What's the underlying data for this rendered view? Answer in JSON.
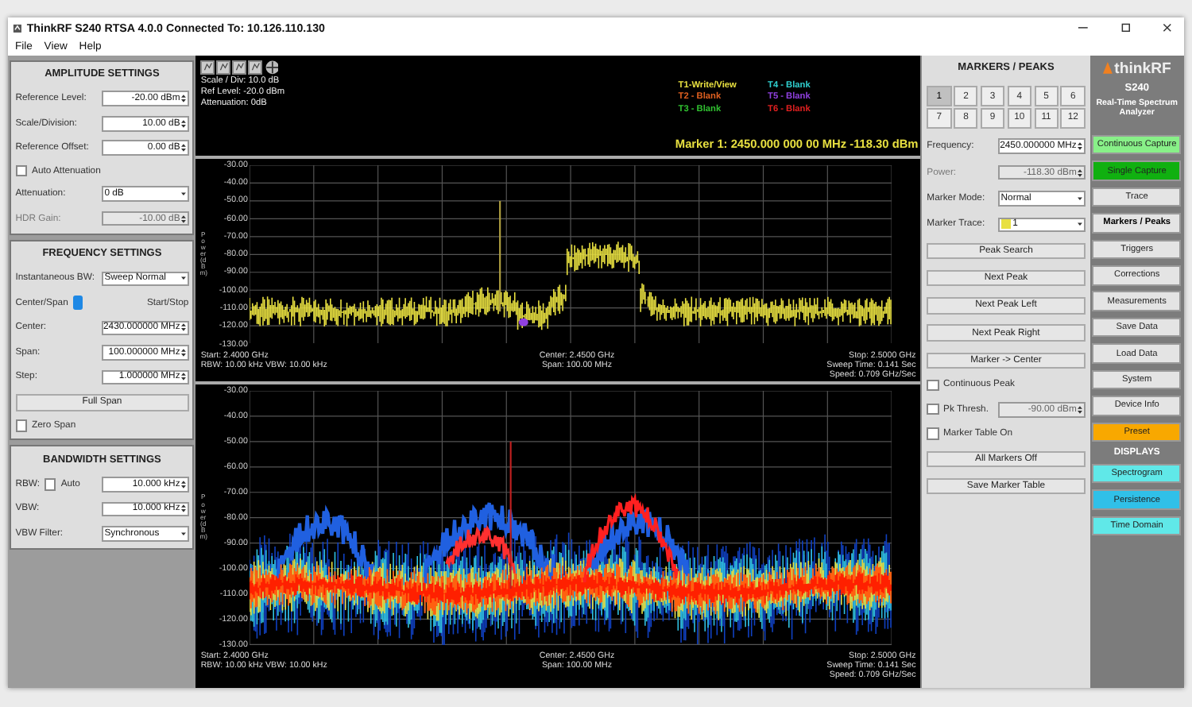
{
  "window": {
    "title": "ThinkRF S240 RTSA 4.0.0  Connected To: 10.126.110.130"
  },
  "menu": [
    "File",
    "View",
    "Help"
  ],
  "left_sections": [
    {
      "title": "AMPLITUDE SETTINGS",
      "rows": [
        {
          "kind": "spin",
          "label": "Reference Level:",
          "value": "-20.00 dBm",
          "disabled": false
        },
        {
          "kind": "spin",
          "label": "Scale/Division:",
          "value": "10.00 dB",
          "disabled": false
        },
        {
          "kind": "spin",
          "label": "Reference Offset:",
          "value": "0.00 dB",
          "disabled": false
        },
        {
          "kind": "checkbox",
          "label": "Auto Attenuation",
          "checked": false,
          "disabled": false
        },
        {
          "kind": "select",
          "label": "Attenuation:",
          "value": "0 dB",
          "disabled": false
        },
        {
          "kind": "spin",
          "label": "HDR Gain:",
          "value": "-10.00 dB",
          "disabled": true
        }
      ]
    },
    {
      "title": "FREQUENCY SETTINGS",
      "rows": [
        {
          "kind": "select",
          "label": "Instantaneous BW:",
          "value": "Sweep Normal",
          "disabled": false
        },
        {
          "kind": "toggle",
          "label": "Center/Span",
          "value": "Start/Stop",
          "on": false,
          "disabled": false
        },
        {
          "kind": "spin",
          "label": "Center:",
          "value": "2430.000000 MHz",
          "disabled": false
        },
        {
          "kind": "spin",
          "label": "Span:",
          "value": "100.000000 MHz",
          "disabled": false
        },
        {
          "kind": "spin",
          "label": "Step:",
          "value": "1.000000 MHz",
          "disabled": false
        },
        {
          "kind": "button",
          "label": "Full Span",
          "disabled": false
        },
        {
          "kind": "checkbox",
          "label": "Zero Span",
          "checked": false,
          "disabled": false
        }
      ]
    },
    {
      "title": "BANDWIDTH SETTINGS",
      "rows": [
        {
          "kind": "spin-auto",
          "label": "RBW:",
          "auto_label": "Auto",
          "checked": false,
          "value": "10.000 kHz",
          "disabled": false
        },
        {
          "kind": "spin",
          "label": "VBW:",
          "value": "10.000 kHz",
          "disabled": false
        },
        {
          "kind": "select",
          "label": "VBW Filter:",
          "value": "Synchronous",
          "disabled": false
        }
      ]
    }
  ],
  "display_info": [
    "Scale / Div: 10.0 dB",
    "Ref Level: -20.0 dBm",
    "Attenuation: 0dB"
  ],
  "traces": [
    {
      "label": "T1-Write/View",
      "color": "#e8e040"
    },
    {
      "label": "T4 - Blank",
      "color": "#30d0d0"
    },
    {
      "label": "T2 - Blank",
      "color": "#e06020"
    },
    {
      "label": "T5 - Blank",
      "color": "#9040e0"
    },
    {
      "label": "T3 - Blank",
      "color": "#30c030"
    },
    {
      "label": "T6 - Blank",
      "color": "#e02020"
    }
  ],
  "marker_readout": "Marker 1: 2450.000 000 00 MHz   -118.30 dBm",
  "plots": [
    {
      "kind": "trace",
      "y_axis_label": "Power (dBm)",
      "y_ticks": [
        "-30.00",
        "-40.00",
        "-50.00",
        "-60.00",
        "-70.00",
        "-80.00",
        "-90.00",
        "-100.00",
        "-110.00",
        "-120.00",
        "-130.00"
      ],
      "footer_left": [
        "Start: 2.4000 GHz",
        "RBW: 10.00 kHz  VBW: 10.00 kHz"
      ],
      "footer_center": [
        "Center: 2.4500 GHz",
        "Span: 100.00 MHz"
      ],
      "footer_right": [
        "Stop: 2.5000 GHz",
        "Sweep Time: 0.141 Sec",
        "Speed: 0.709 GHz/Sec"
      ]
    },
    {
      "kind": "persistence",
      "y_axis_label": "Power (dBm)",
      "y_ticks": [
        "-30.00",
        "-40.00",
        "-50.00",
        "-60.00",
        "-70.00",
        "-80.00",
        "-90.00",
        "-100.00",
        "-110.00",
        "-120.00",
        "-130.00"
      ],
      "footer_left": [
        "Start: 2.4000 GHz",
        "RBW: 10.00 kHz  VBW: 10.00 kHz"
      ],
      "footer_center": [
        "Center: 2.4500 GHz",
        "Span: 100.00 MHz"
      ],
      "footer_right": [
        "Stop: 2.5000 GHz",
        "Sweep Time: 0.141 Sec",
        "Speed: 0.709 GHz/Sec"
      ]
    }
  ],
  "markers": {
    "title": "MARKERS / PEAKS",
    "tabs": [
      {
        "label": "1",
        "selected": true
      },
      {
        "label": "2",
        "selected": false
      },
      {
        "label": "3",
        "selected": false
      },
      {
        "label": "4",
        "selected": false
      },
      {
        "label": "5",
        "selected": false
      },
      {
        "label": "6",
        "selected": false
      },
      {
        "label": "7",
        "selected": false
      },
      {
        "label": "8",
        "selected": false
      },
      {
        "label": "9",
        "selected": false
      },
      {
        "label": "10",
        "selected": false
      },
      {
        "label": "11",
        "selected": false
      },
      {
        "label": "12",
        "selected": false
      }
    ],
    "rows": [
      {
        "kind": "spin",
        "label": "Frequency:",
        "value": "2450.000000 MHz",
        "disabled": false
      },
      {
        "kind": "spin",
        "label": "Power:",
        "value": "-118.30 dBm",
        "disabled": true
      },
      {
        "kind": "select",
        "label": "Marker Mode:",
        "value": "Normal",
        "disabled": false
      },
      {
        "kind": "trace-select",
        "label": "Marker Trace:",
        "value": "1",
        "color": "#e8e040",
        "disabled": false
      },
      {
        "kind": "button",
        "label": "Peak Search",
        "disabled": false
      },
      {
        "kind": "button",
        "label": "Next Peak",
        "disabled": false
      },
      {
        "kind": "button",
        "label": "Next Peak Left",
        "disabled": false
      },
      {
        "kind": "button",
        "label": "Next Peak Right",
        "disabled": false
      },
      {
        "kind": "button",
        "label": "Marker -> Center",
        "disabled": false
      },
      {
        "kind": "checkbox",
        "label": "Continuous Peak",
        "checked": false,
        "disabled": false
      },
      {
        "kind": "check-spin",
        "label": "Pk Thresh.",
        "checked": false,
        "value": "-90.00 dBm",
        "disabled": true
      },
      {
        "kind": "checkbox",
        "label": "Marker Table On",
        "checked": false,
        "disabled": false
      },
      {
        "kind": "button",
        "label": "All Markers Off",
        "disabled": false
      },
      {
        "kind": "button",
        "label": "Save Marker Table",
        "disabled": false
      }
    ]
  },
  "brand": {
    "name": "thinkRF",
    "model": "S240",
    "subtitle": "Real-Time Spectrum Analyzer"
  },
  "controls": [
    {
      "label": "Continuous Capture",
      "color": "#88f088",
      "selected": false
    },
    {
      "label": "Single Capture",
      "color": "#10b010",
      "selected": false
    },
    {
      "label": "Trace",
      "selected": false
    },
    {
      "label": "Markers / Peaks",
      "selected": true
    },
    {
      "label": "Triggers",
      "selected": false
    },
    {
      "label": "Corrections",
      "selected": false
    },
    {
      "label": "Measurements",
      "selected": false
    },
    {
      "label": "Save Data",
      "selected": false
    },
    {
      "label": "Load Data",
      "selected": false
    },
    {
      "label": "System",
      "selected": false
    },
    {
      "label": "Device Info",
      "selected": false
    },
    {
      "label": "Preset",
      "color": "#f8a800",
      "selected": false
    }
  ],
  "displays_title": "DISPLAYS",
  "displays": [
    {
      "label": "Spectrogram",
      "color": "#60e8e8",
      "selected": false
    },
    {
      "label": "Persistence",
      "color": "#30c0e8",
      "selected": false
    },
    {
      "label": "Time Domain",
      "color": "#60e8e8",
      "selected": false
    }
  ]
}
